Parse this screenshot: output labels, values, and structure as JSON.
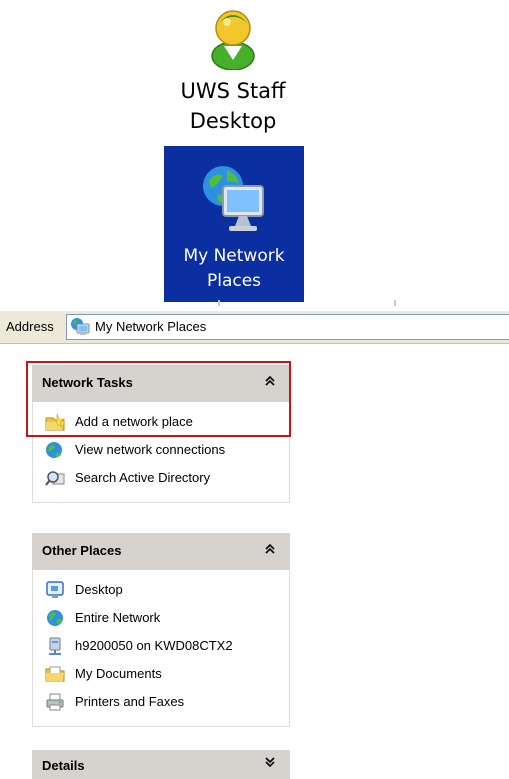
{
  "desktop": {
    "staff_icon": {
      "label_line1": "UWS Staff",
      "label_line2": "Desktop",
      "icon": "user-icon"
    },
    "network_icon": {
      "label_line1": "My Network",
      "label_line2": "Places",
      "icon": "network-places-icon",
      "selected": true
    }
  },
  "address_bar": {
    "label": "Address",
    "value": "My Network Places",
    "icon": "network-places-icon"
  },
  "network_tasks": {
    "title": "Network Tasks",
    "toggle_icon": "chevron-up-double-icon",
    "items": [
      {
        "label": "Add a network place",
        "icon": "add-network-place-icon"
      },
      {
        "label": "View network connections",
        "icon": "network-connections-icon"
      },
      {
        "label": "Search Active Directory",
        "icon": "search-directory-icon"
      }
    ]
  },
  "other_places": {
    "title": "Other Places",
    "toggle_icon": "chevron-up-double-icon",
    "items": [
      {
        "label": "Desktop",
        "icon": "desktop-icon"
      },
      {
        "label": "Entire Network",
        "icon": "globe-icon"
      },
      {
        "label": "h9200050 on KWD08CTX2",
        "icon": "network-drive-icon"
      },
      {
        "label": "My Documents",
        "icon": "folder-icon"
      },
      {
        "label": "Printers and Faxes",
        "icon": "printer-icon"
      }
    ]
  },
  "details": {
    "title": "Details",
    "toggle_icon": "chevron-down-double-icon"
  },
  "colors": {
    "selection": "#0b2fa0",
    "highlight_border": "#c0161c",
    "panel_header": "#d6d3ce",
    "address_bar_bg": "#ece9d8"
  }
}
